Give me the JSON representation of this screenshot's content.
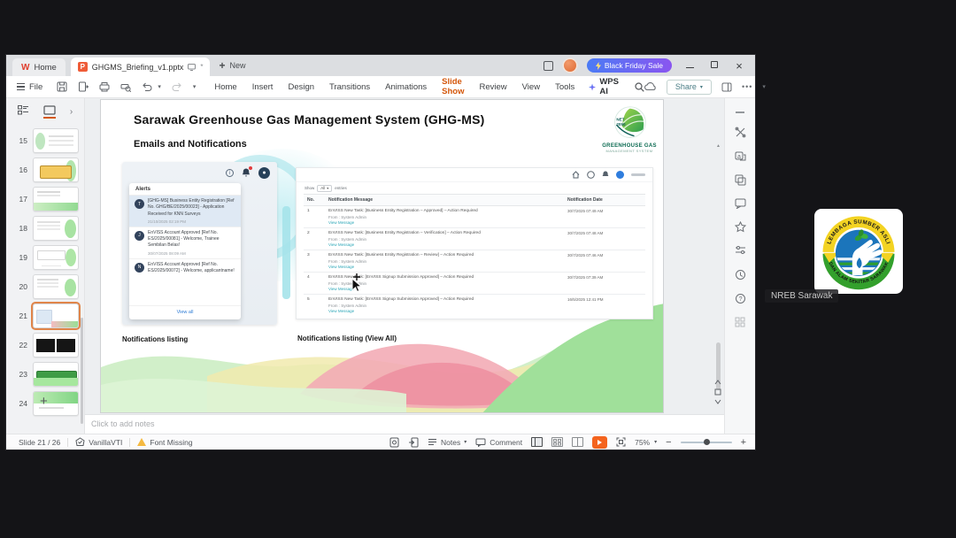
{
  "meeting": {
    "participant": "NREB Sarawak",
    "emblem_top_text": "LEMBAGA SUMBER ASLI",
    "emblem_bottom_text": "DAN ALAM SEKITAR SARAWAK"
  },
  "titlebar": {
    "home_tab": "Home",
    "doc_tab": "GHGMS_Briefing_v1.pptx",
    "new_tab": "New",
    "promo": "Black Friday Sale"
  },
  "ribbon": {
    "file": "File",
    "menus": [
      "Home",
      "Insert",
      "Design",
      "Transitions",
      "Animations",
      "Slide Show",
      "Review",
      "View",
      "Tools"
    ],
    "wps_ai": "WPS AI",
    "share": "Share"
  },
  "thumbnails": {
    "slides": [
      {
        "num": "15"
      },
      {
        "num": "16"
      },
      {
        "num": "17"
      },
      {
        "num": "18"
      },
      {
        "num": "19"
      },
      {
        "num": "20"
      },
      {
        "num": "21"
      },
      {
        "num": "22"
      },
      {
        "num": "23"
      },
      {
        "num": "24"
      }
    ],
    "add_label": "+"
  },
  "slide": {
    "title": "Sarawak Greenhouse Gas Management System (GHG-MS)",
    "subtitle": "Emails and Notifications",
    "logo_badge_line1": "NET",
    "logo_badge_line2": "2050",
    "logo_name": "GREENHOUSE GAS",
    "logo_sub": "MANAGEMENT SYSTEM",
    "caption_left": "Notifications listing",
    "caption_right": "Notifications listing (View All)",
    "alerts": {
      "header": "Alerts",
      "items": [
        {
          "initial": "T",
          "text": "[GHG-MS] Business Entity Registration [Ref No. GHG/BE/2025/00023] - Application Received for KNN Surveys",
          "time": "21/10/2025 02:19 PM"
        },
        {
          "initial": "J",
          "text": "EnVISS Account Approved [Ref No. ES/2025/00081] - Welcome, Trainee Sembilan Belas!",
          "time": "30/07/2025 08:09 AM"
        },
        {
          "initial": "N",
          "text": "EnVISS Account Approved [Ref No. ES/2025/00072] - Welcome, applicantname!",
          "time": ""
        }
      ],
      "view_all": "View all"
    },
    "portal": {
      "show_label": "Show",
      "show_value": "All",
      "entries_label": "entries",
      "col_no": "No.",
      "col_message": "Notification Message",
      "col_date": "Notification Date",
      "from_label": "From : System Admin",
      "link_label": "View Message",
      "rows": [
        {
          "no": "1",
          "message": "EnVISS New Task: [Business Entity Registration – Approved] – Action Required",
          "date": "30/7/2025 07:49 AM"
        },
        {
          "no": "2",
          "message": "EnVISS New Task: [Business Entity Registration – Verification] – Action Required",
          "date": "30/7/2025 07:48 AM"
        },
        {
          "no": "3",
          "message": "EnVISS New Task: [Business Entity Registration – Review] – Action Required",
          "date": "30/7/2025 07:46 AM"
        },
        {
          "no": "4",
          "message": "EnVISS New Task: [EnVISS Signup Submission Approved] – Action Required",
          "date": "30/7/2025 07:39 AM"
        },
        {
          "no": "5",
          "message": "EnVISS New Task: [EnVISS Signup Submission Approved] – Action Required",
          "date": "16/5/2025 12:41 PM"
        }
      ]
    }
  },
  "notes_placeholder": "Click to add notes",
  "statusbar": {
    "slide_info": "Slide 21 / 26",
    "theme_name": "VanillaVTI",
    "font_missing": "Font Missing",
    "notes": "Notes",
    "comment": "Comment",
    "zoom": "75%"
  }
}
